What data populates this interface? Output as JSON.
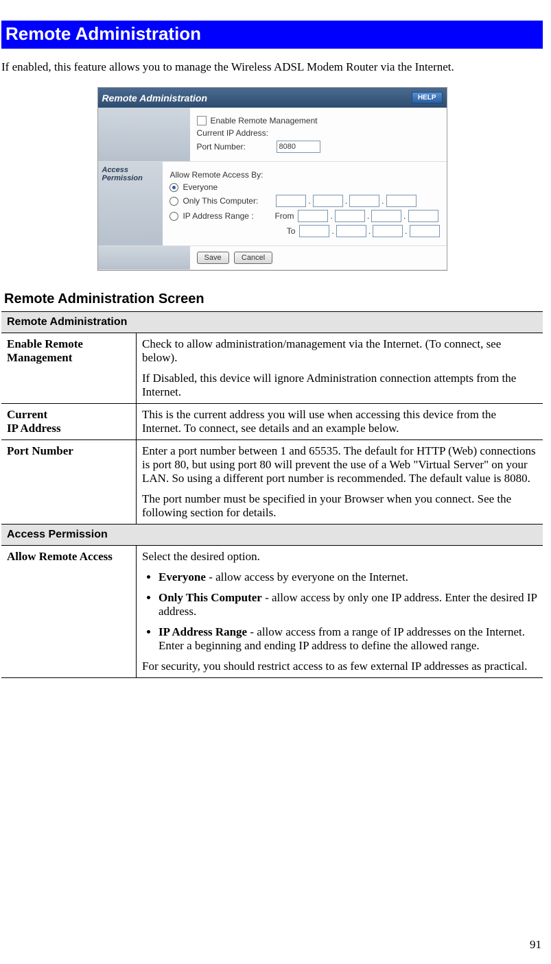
{
  "page_number": "91",
  "title": "Remote Administration",
  "intro": "If enabled, this feature allows you to manage the Wireless ADSL Modem Router via the Internet.",
  "shot": {
    "header": "Remote  Administration",
    "help": "HELP",
    "section_access": "Access Permission",
    "enable_label": "Enable Remote Management",
    "current_ip_label": "Current IP Address:",
    "port_label": "Port Number:",
    "port_value": "8080",
    "allow_label": "Allow Remote Access By:",
    "opt_everyone": "Everyone",
    "opt_only": "Only This Computer:",
    "opt_range": "IP Address Range :",
    "from": "From",
    "to": "To",
    "save": "Save",
    "cancel": "Cancel"
  },
  "table": {
    "heading": "Remote Administration Screen",
    "sec1": "Remote Administration",
    "row1_label": "Enable Remote Management",
    "row1_p1": "Check to allow administration/management via the Internet. (To connect, see below).",
    "row1_p2": "If Disabled, this device will ignore Administration connection attempts from the Internet.",
    "row2_label1": "Current",
    "row2_label2": "IP Address",
    "row2_p1": "This is the current address you will use when accessing this device from the Internet. To connect, see details and an example below.",
    "row3_label": "Port Number",
    "row3_p1": "Enter a port number between 1 and 65535. The default for HTTP (Web) connections is port 80, but using port 80 will prevent the use of a Web \"Virtual Server\" on your LAN. So using a different port number is recommended. The default value is 8080.",
    "row3_p2": "The port number must be specified in your Browser when you connect. See the following section for details.",
    "sec2": "Access Permission",
    "row4_label": "Allow Remote Access",
    "row4_intro": "Select the desired option.",
    "row4_b1": "Everyone",
    "row4_t1": " - allow access by everyone on the Internet.",
    "row4_b2": "Only This Computer",
    "row4_t2": " - allow access by only one IP address. Enter the desired IP address.",
    "row4_b3": "IP Address Range",
    "row4_t3": " - allow access from a range of IP addresses on the Internet. Enter a beginning and ending IP address to define the allowed range.",
    "row4_outro": "For security, you should restrict access to as few external IP addresses as practical."
  }
}
